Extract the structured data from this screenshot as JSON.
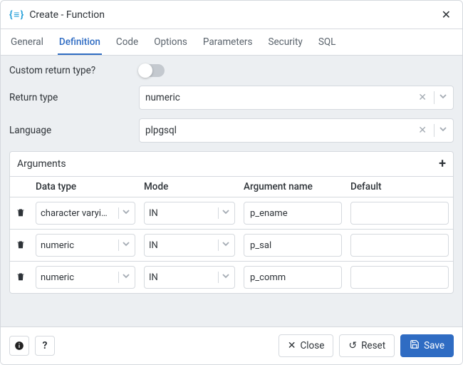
{
  "title": "Create - Function",
  "tabs": {
    "general": "General",
    "definition": "Definition",
    "code": "Code",
    "options": "Options",
    "parameters": "Parameters",
    "security": "Security",
    "sql": "SQL"
  },
  "active_tab": "definition",
  "definition": {
    "custom_return_type_label": "Custom return type?",
    "custom_return_type_on": false,
    "return_type_label": "Return type",
    "return_type_value": "numeric",
    "language_label": "Language",
    "language_value": "plpgsql"
  },
  "arguments": {
    "section_label": "Arguments",
    "columns": {
      "data_type": "Data type",
      "mode": "Mode",
      "name": "Argument name",
      "default": "Default"
    },
    "rows": [
      {
        "data_type": "character varyi…",
        "mode": "IN",
        "name": "p_ename",
        "default": ""
      },
      {
        "data_type": "numeric",
        "mode": "IN",
        "name": "p_sal",
        "default": ""
      },
      {
        "data_type": "numeric",
        "mode": "IN",
        "name": "p_comm",
        "default": ""
      }
    ]
  },
  "footer": {
    "close": "Close",
    "reset": "Reset",
    "save": "Save"
  }
}
